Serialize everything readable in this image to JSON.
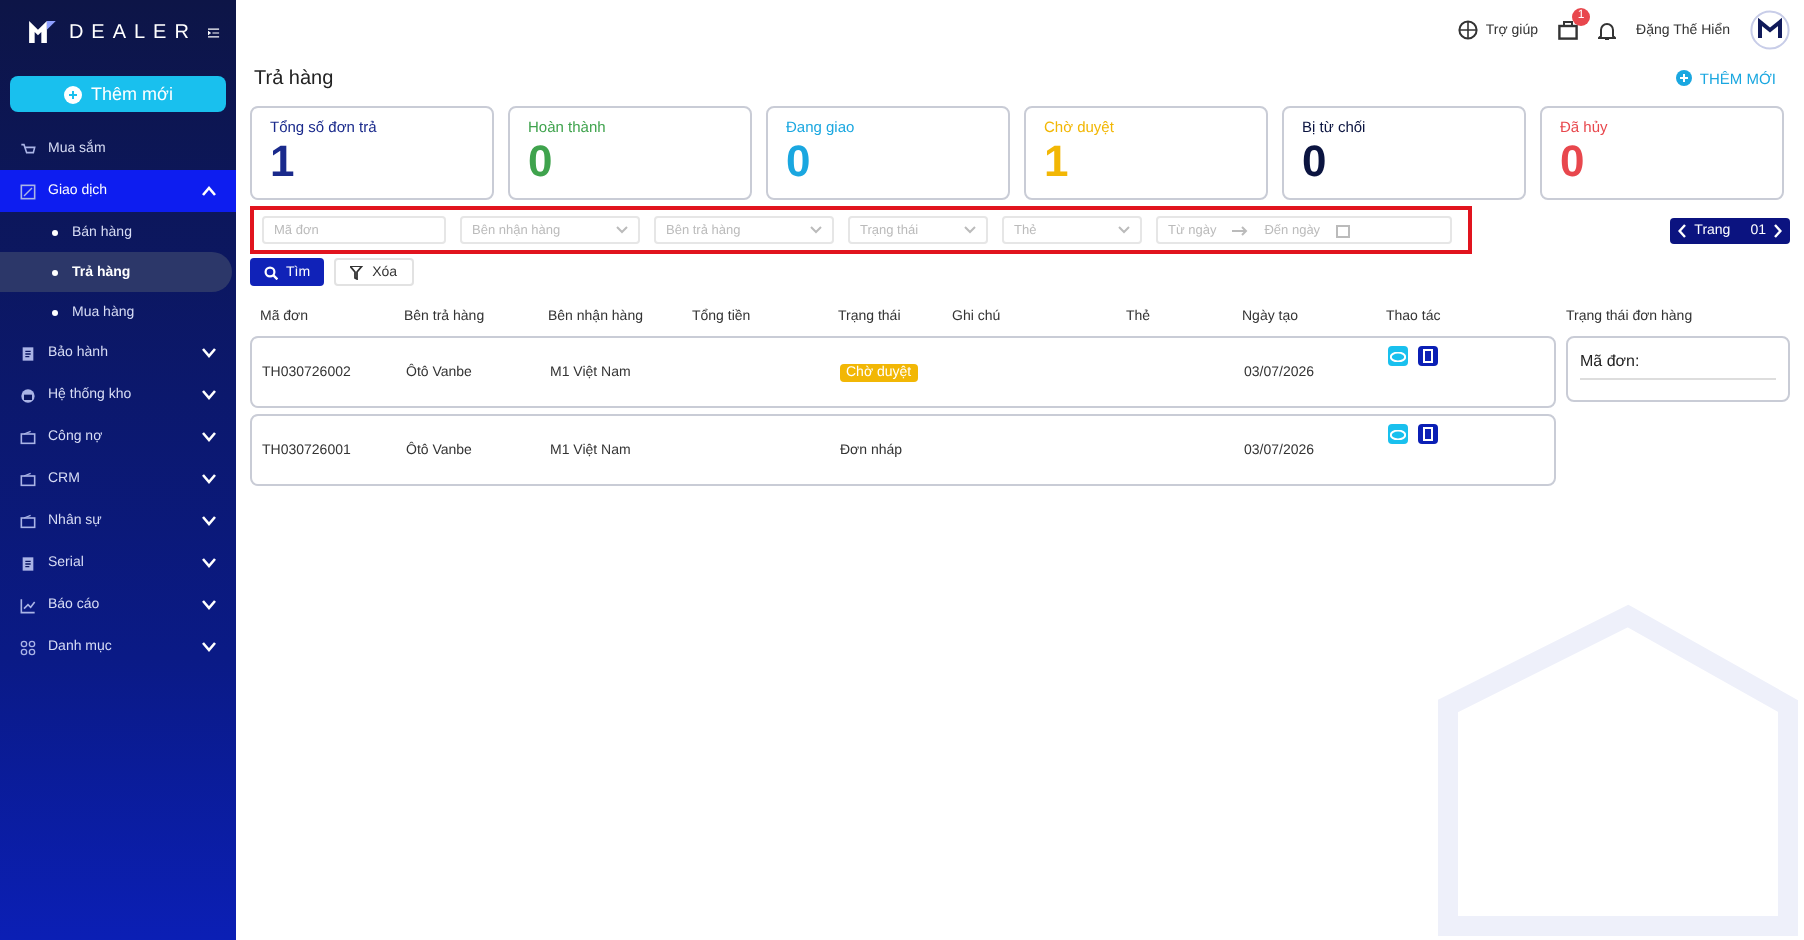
{
  "sidebar": {
    "brand": "DEALER",
    "new_button": "Thêm mới",
    "items": [
      {
        "label": "Mua sắm",
        "selected": false
      },
      {
        "label": "Giao dịch",
        "selected": true,
        "expanded": true,
        "children": [
          {
            "label": "Bán hàng",
            "selected": false
          },
          {
            "label": "Trả hàng",
            "selected": true
          },
          {
            "label": "Mua hàng",
            "selected": false
          }
        ]
      },
      {
        "label": "Bảo hành",
        "selected": false,
        "expanded": false
      },
      {
        "label": "Hệ thống kho",
        "selected": false,
        "expanded": false
      },
      {
        "label": "Công nợ",
        "selected": false,
        "expanded": false
      },
      {
        "label": "CRM",
        "selected": false,
        "expanded": false
      },
      {
        "label": "Nhân sự",
        "selected": false,
        "expanded": false
      },
      {
        "label": "Serial",
        "selected": false,
        "expanded": false
      },
      {
        "label": "Báo cáo",
        "selected": false,
        "expanded": false
      },
      {
        "label": "Danh mục",
        "selected": false,
        "expanded": false
      }
    ]
  },
  "header": {
    "help": "Trợ giúp",
    "cart_count": "1",
    "user": "Đặng Thế Hiển"
  },
  "page": {
    "title": "Trả hàng",
    "add_link": "THÊM MỚI"
  },
  "stats": [
    {
      "label": "Tổng số đơn trả",
      "value": "1",
      "color": "#1a2a8c"
    },
    {
      "label": "Hoàn thành",
      "value": "0",
      "color": "#3fa34d"
    },
    {
      "label": "Đang giao",
      "value": "0",
      "color": "#1aa7e0"
    },
    {
      "label": "Chờ duyệt",
      "value": "1",
      "color": "#f2b705"
    },
    {
      "label": "Bị từ chối",
      "value": "0",
      "color": "#0b1440"
    },
    {
      "label": "Đã hủy",
      "value": "0",
      "color": "#e8474d"
    }
  ],
  "filters": {
    "highlighted": true,
    "fields": [
      {
        "kind": "text",
        "placeholder": "Mã đơn"
      },
      {
        "kind": "select",
        "placeholder": "Bên nhận hàng"
      },
      {
        "kind": "select",
        "placeholder": "Bên trả hàng"
      },
      {
        "kind": "select",
        "placeholder": "Trạng thái"
      },
      {
        "kind": "select",
        "placeholder": "Thẻ"
      },
      {
        "kind": "daterange",
        "placeholder": "Từ ngày",
        "placeholder_end": "Đến ngày"
      }
    ],
    "search_button": "Tìm",
    "clear_button": "Xóa"
  },
  "pager": {
    "label": "Trang",
    "page": "01"
  },
  "table": {
    "columns": [
      "Mã đơn",
      "Bên trả hàng",
      "Bên nhận hàng",
      "Tổng tiền",
      "Trạng thái",
      "Ghi chú",
      "Thẻ",
      "Ngày tạo",
      "Thao tác"
    ],
    "rows": [
      {
        "code": "TH030726002",
        "from": "Ôtô Vanbe",
        "to": "M1 Việt Nam",
        "status": "Chờ duyệt",
        "kind": "badge",
        "date": "03/07/2026"
      },
      {
        "code": "TH030726001",
        "from": "Ôtô Vanbe",
        "to": "M1 Việt Nam",
        "status": "Đơn nháp",
        "kind": "plain",
        "date": "03/07/2026"
      }
    ]
  },
  "status_panel": {
    "title": "Trạng thái đơn hàng",
    "label": "Mã đơn:"
  }
}
